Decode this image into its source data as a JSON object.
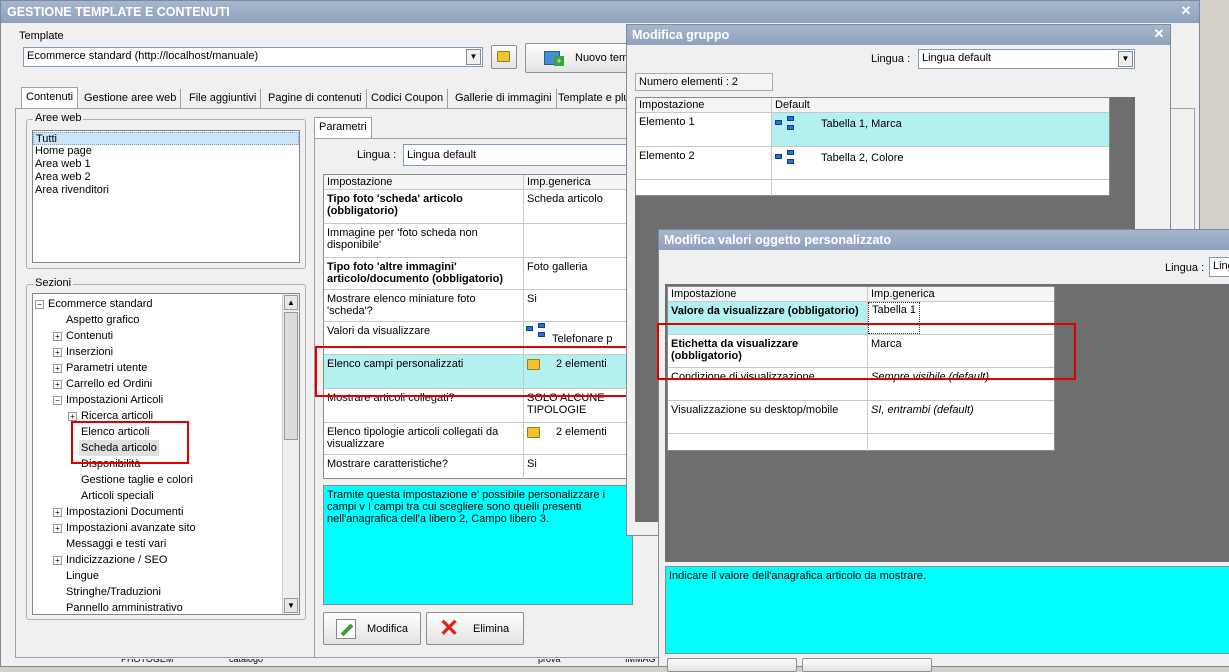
{
  "main_window": {
    "title": "GESTIONE TEMPLATE E CONTENUTI",
    "template_label": "Template",
    "template_value": "Ecommerce standard (http://localhost/manuale)",
    "new_button": "Nuovo tem",
    "tabs": [
      "Contenuti",
      "Gestione aree web",
      "File aggiuntivi",
      "Pagine di contenuti",
      "Codici Coupon",
      "Gallerie di immagini",
      "Template e plu"
    ],
    "aree_web": {
      "label": "Aree web",
      "items": [
        "Tutti",
        "Home page",
        "Area web 1",
        "Area web 2",
        "Area rivenditori"
      ]
    },
    "sezioni": {
      "label": "Sezioni",
      "items": [
        {
          "text": "Ecommerce standard",
          "exp": "−"
        },
        {
          "text": "Aspetto grafico",
          "exp": ""
        },
        {
          "text": "Contenuti",
          "exp": "+"
        },
        {
          "text": "Inserzioni",
          "exp": "+"
        },
        {
          "text": "Parametri utente",
          "exp": "+"
        },
        {
          "text": "Carrello ed Ordini",
          "exp": "+"
        },
        {
          "text": "Impostazioni Articoli",
          "exp": "−"
        },
        {
          "text": "Ricerca articoli",
          "exp": "+"
        },
        {
          "text": "Elenco articoli",
          "exp": ""
        },
        {
          "text": "Scheda articolo",
          "exp": ""
        },
        {
          "text": "Disponibilità",
          "exp": ""
        },
        {
          "text": "Gestione taglie e colori",
          "exp": ""
        },
        {
          "text": "Articoli speciali",
          "exp": ""
        },
        {
          "text": "Impostazioni Documenti",
          "exp": "+"
        },
        {
          "text": "Impostazioni avanzate sito",
          "exp": "+"
        },
        {
          "text": "Messaggi e testi vari",
          "exp": ""
        },
        {
          "text": "Indicizzazione / SEO",
          "exp": "+"
        },
        {
          "text": "Lingue",
          "exp": ""
        },
        {
          "text": "Stringhe/Traduzioni",
          "exp": ""
        },
        {
          "text": "Pannello amministrativo",
          "exp": ""
        }
      ]
    },
    "parametri_tab": "Parametri",
    "lingua_label": "Lingua :",
    "lingua_value": "Lingua default",
    "grid": {
      "headers": [
        "Impostazione",
        "Imp.generica"
      ],
      "rows": [
        {
          "setting": "Tipo foto 'scheda' articolo (obbligatorio)",
          "value": "Scheda articolo"
        },
        {
          "setting": "Immagine per 'foto scheda non disponibile'",
          "value": ""
        },
        {
          "setting": "Tipo foto 'altre immagini' articolo/documento (obbligatorio)",
          "value": "Foto galleria"
        },
        {
          "setting": "Mostrare elenco miniature foto 'scheda'?",
          "value": "Si"
        },
        {
          "setting": "Valori da visualizzare",
          "value": "Telefonare p"
        },
        {
          "setting": "Elenco campi personalizzati",
          "value": "2 elementi"
        },
        {
          "setting": "Mostrare articoli collegati?",
          "value": "SOLO ALCUNE TIPOLOGIE"
        },
        {
          "setting": "Elenco tipologie articoli collegati da visualizzare",
          "value": "2 elementi"
        },
        {
          "setting": "Mostrare caratteristiche?",
          "value": "Si"
        }
      ]
    },
    "description": "Tramite questa impostazione e' possibile personalizzare i campi v I campi tra cui scegliere sono quelli presenti nell'anagrafica dell'a libero 2, Campo libero 3.",
    "modifica_button": "Modifica",
    "elimina_button": "Elimina",
    "status_fragments": [
      "PHOTOGEM",
      "catalogo",
      "prova",
      "IMMAG"
    ]
  },
  "modifica_gruppo": {
    "title": "Modifica gruppo",
    "lingua_label": "Lingua :",
    "lingua_value": "Lingua default",
    "count_label": "Numero elementi : 2",
    "headers": [
      "Impostazione",
      "Default"
    ],
    "rows": [
      {
        "name": "Elemento 1",
        "value": "Tabella 1, Marca"
      },
      {
        "name": "Elemento 2",
        "value": "Tabella 2, Colore"
      }
    ]
  },
  "modifica_valori": {
    "title": "Modifica valori oggetto personalizzato",
    "lingua_label": "Lingua :",
    "lingua_value": "Ling",
    "headers": [
      "Impostazione",
      "Imp.generica"
    ],
    "rows": [
      {
        "setting": "Valore da visualizzare (obbligatorio)",
        "value": "Tabella 1"
      },
      {
        "setting": "Etichetta da visualizzare (obbligatorio)",
        "value": "Marca"
      },
      {
        "setting": "Condizione di visualizzazione",
        "value": "Sempre visibile (default)"
      },
      {
        "setting": "Visualizzazione su desktop/mobile",
        "value": "SI, entrambi (default)"
      }
    ],
    "description": "Indicare il valore dell'anagrafica articolo da mostrare."
  },
  "colors": {
    "highlight": "#00ffff",
    "selected_row": "#b3f0f0",
    "annotation": "#e00000",
    "titlebar": "#8ea1bd"
  }
}
